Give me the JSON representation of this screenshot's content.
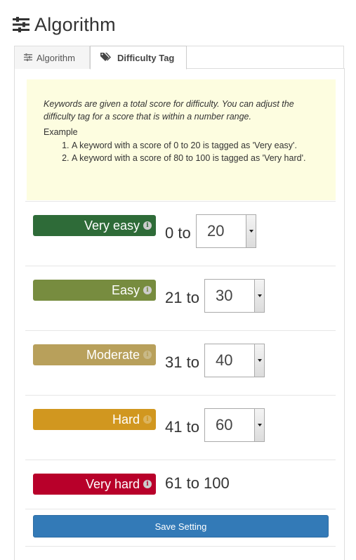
{
  "page": {
    "title": "Algorithm",
    "icon": "sliders-icon"
  },
  "tabs": [
    {
      "label": "Algorithm",
      "icon": "sliders-icon",
      "active": false
    },
    {
      "label": "Difficulty Tag",
      "icon": "tags-icon",
      "active": true
    }
  ],
  "info": {
    "text": "Keywords are given a total score for difficulty. You can adjust the difficulty tag for a score that is within a number range.",
    "example_label": "Example",
    "examples": [
      "A keyword with a score of 0 to 20 is tagged as 'Very easy'.",
      "A keyword with a score of 80 to 100 is tagged as 'Very hard'."
    ],
    "background": "#fdfde0"
  },
  "tags": [
    {
      "label": "Very easy",
      "color": "#2e6b38",
      "from": "0 to",
      "to": "20",
      "has_select": true
    },
    {
      "label": "Easy",
      "color": "#778c3f",
      "from": "21 to",
      "to": "30",
      "has_select": true
    },
    {
      "label": "Moderate",
      "color": "#b8a05b",
      "from": "31 to",
      "to": "40",
      "has_select": true
    },
    {
      "label": "Hard",
      "color": "#d1971f",
      "from": "41 to",
      "to": "60",
      "has_select": true
    },
    {
      "label": "Very hard",
      "color": "#b8002a",
      "range_text": "61 to 100",
      "has_select": false
    }
  ],
  "save_label": "Save Setting",
  "colors": {
    "primary_button": "#337ab7"
  }
}
